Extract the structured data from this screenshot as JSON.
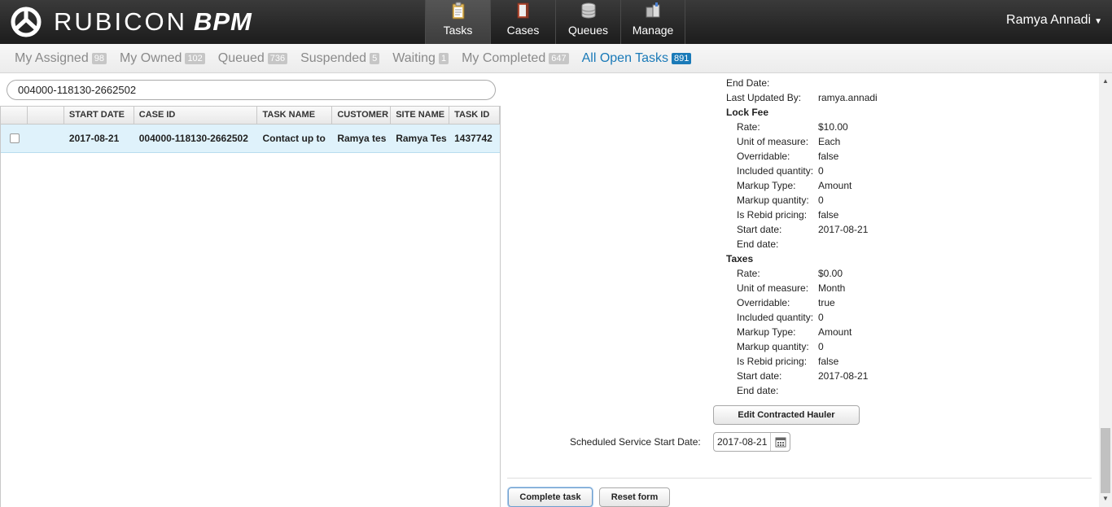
{
  "app": {
    "logo_text": "RUBICON",
    "logo_suffix": "BPM",
    "user_name": "Ramya Annadi"
  },
  "nav": {
    "tabs": [
      {
        "label": "Tasks",
        "icon": "clipboard-icon",
        "active": true
      },
      {
        "label": "Cases",
        "icon": "folder-icon",
        "active": false
      },
      {
        "label": "Queues",
        "icon": "database-icon",
        "active": false
      },
      {
        "label": "Manage",
        "icon": "manage-icon",
        "active": false
      }
    ]
  },
  "filters": [
    {
      "label": "My Assigned",
      "count": "98"
    },
    {
      "label": "My Owned",
      "count": "102"
    },
    {
      "label": "Queued",
      "count": "736"
    },
    {
      "label": "Suspended",
      "count": "5"
    },
    {
      "label": "Waiting",
      "count": "1"
    },
    {
      "label": "My Completed",
      "count": "647"
    },
    {
      "label": "All Open Tasks",
      "count": "891",
      "active": true
    }
  ],
  "search": {
    "value": "004000-118130-2662502"
  },
  "grid": {
    "columns": [
      "",
      "",
      "START DATE",
      "CASE ID",
      "TASK NAME",
      "CUSTOMER",
      "SITE NAME",
      "TASK ID"
    ],
    "rows": [
      {
        "start_date": "2017-08-21",
        "case_id": "004000-118130-2662502",
        "task_name": "Contact up to",
        "customer": "Ramya tes",
        "site_name": "Ramya Tes",
        "task_id": "1437742"
      }
    ]
  },
  "detail": {
    "end_date_label": "End Date:",
    "last_updated_label": "Last Updated By:",
    "last_updated_value": "ramya.annadi",
    "lock_fee": {
      "title": "Lock Fee",
      "rate_label": "Rate:",
      "rate": "$10.00",
      "uom_label": "Unit of measure:",
      "uom": "Each",
      "overridable_label": "Overridable:",
      "overridable": "false",
      "included_label": "Included quantity:",
      "included": "0",
      "markup_type_label": "Markup Type:",
      "markup_type": "Amount",
      "markup_qty_label": "Markup quantity:",
      "markup_qty": "0",
      "rebid_label": "Is Rebid pricing:",
      "rebid": "false",
      "start_label": "Start date:",
      "start": "2017-08-21",
      "end_label": "End date:"
    },
    "taxes": {
      "title": "Taxes",
      "rate_label": "Rate:",
      "rate": "$0.00",
      "uom_label": "Unit of measure:",
      "uom": "Month",
      "overridable_label": "Overridable:",
      "overridable": "true",
      "included_label": "Included quantity:",
      "included": "0",
      "markup_type_label": "Markup Type:",
      "markup_type": "Amount",
      "markup_qty_label": "Markup quantity:",
      "markup_qty": "0",
      "rebid_label": "Is Rebid pricing:",
      "rebid": "false",
      "start_label": "Start date:",
      "start": "2017-08-21",
      "end_label": "End date:"
    },
    "edit_hauler_button": "Edit Contracted Hauler",
    "scheduled_label": "Scheduled Service Start Date:",
    "scheduled_value": "2017-08-21",
    "complete_button": "Complete task",
    "reset_button": "Reset form"
  }
}
